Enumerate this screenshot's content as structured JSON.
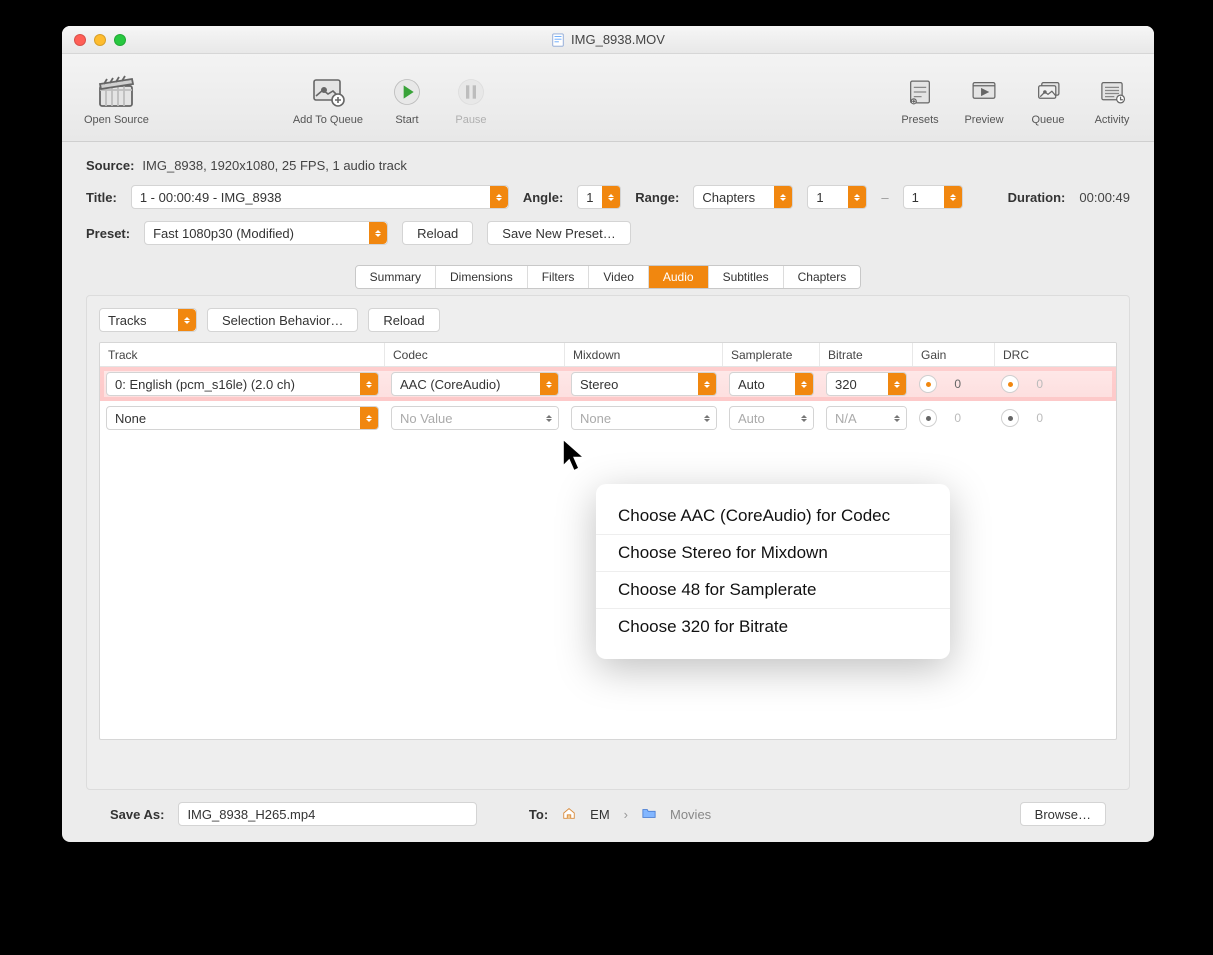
{
  "title": "IMG_8938.MOV",
  "toolbar": {
    "open": "Open Source",
    "queue_add": "Add To Queue",
    "start": "Start",
    "pause": "Pause",
    "presets": "Presets",
    "preview": "Preview",
    "queue": "Queue",
    "activity": "Activity"
  },
  "source": {
    "label": "Source:",
    "value": "IMG_8938, 1920x1080, 25 FPS, 1 audio track"
  },
  "titleRow": {
    "label": "Title:",
    "value": "1 - 00:00:49 - IMG_8938",
    "angleLabel": "Angle:",
    "angle": "1",
    "rangeLabel": "Range:",
    "range": "Chapters",
    "from": "1",
    "to": "1",
    "dash": "–",
    "durationLabel": "Duration:",
    "duration": "00:00:49"
  },
  "presetRow": {
    "label": "Preset:",
    "value": "Fast 1080p30 (Modified)",
    "reload": "Reload",
    "saveNew": "Save New Preset…"
  },
  "tabs": [
    "Summary",
    "Dimensions",
    "Filters",
    "Video",
    "Audio",
    "Subtitles",
    "Chapters"
  ],
  "activeTab": "Audio",
  "panel": {
    "tracks": "Tracks",
    "selection": "Selection Behavior…",
    "reload": "Reload",
    "headers": {
      "track": "Track",
      "codec": "Codec",
      "mix": "Mixdown",
      "sr": "Samplerate",
      "br": "Bitrate",
      "gain": "Gain",
      "drc": "DRC"
    },
    "rows": [
      {
        "track": "0: English (pcm_s16le)  (2.0 ch)",
        "codec": "AAC (CoreAudio)",
        "mix": "Stereo",
        "sr": "Auto",
        "br": "320",
        "gain": "0",
        "drc": "0",
        "accent": true,
        "hl": true
      },
      {
        "track": "None",
        "codec": "No Value",
        "mix": "None",
        "sr": "Auto",
        "br": "N/A",
        "gain": "0",
        "drc": "0",
        "accent": false,
        "hl": false
      }
    ]
  },
  "menu": [
    "Choose AAC (CoreAudio) for Codec",
    "Choose Stereo for Mixdown",
    "Choose 48 for Samplerate",
    "Choose 320 for Bitrate"
  ],
  "footer": {
    "saveAsLabel": "Save As:",
    "saveAsValue": "IMG_8938_H265.mp4",
    "toLabel": "To:",
    "path1": "EM",
    "path2": "Movies",
    "sep": "›",
    "browse": "Browse…"
  }
}
